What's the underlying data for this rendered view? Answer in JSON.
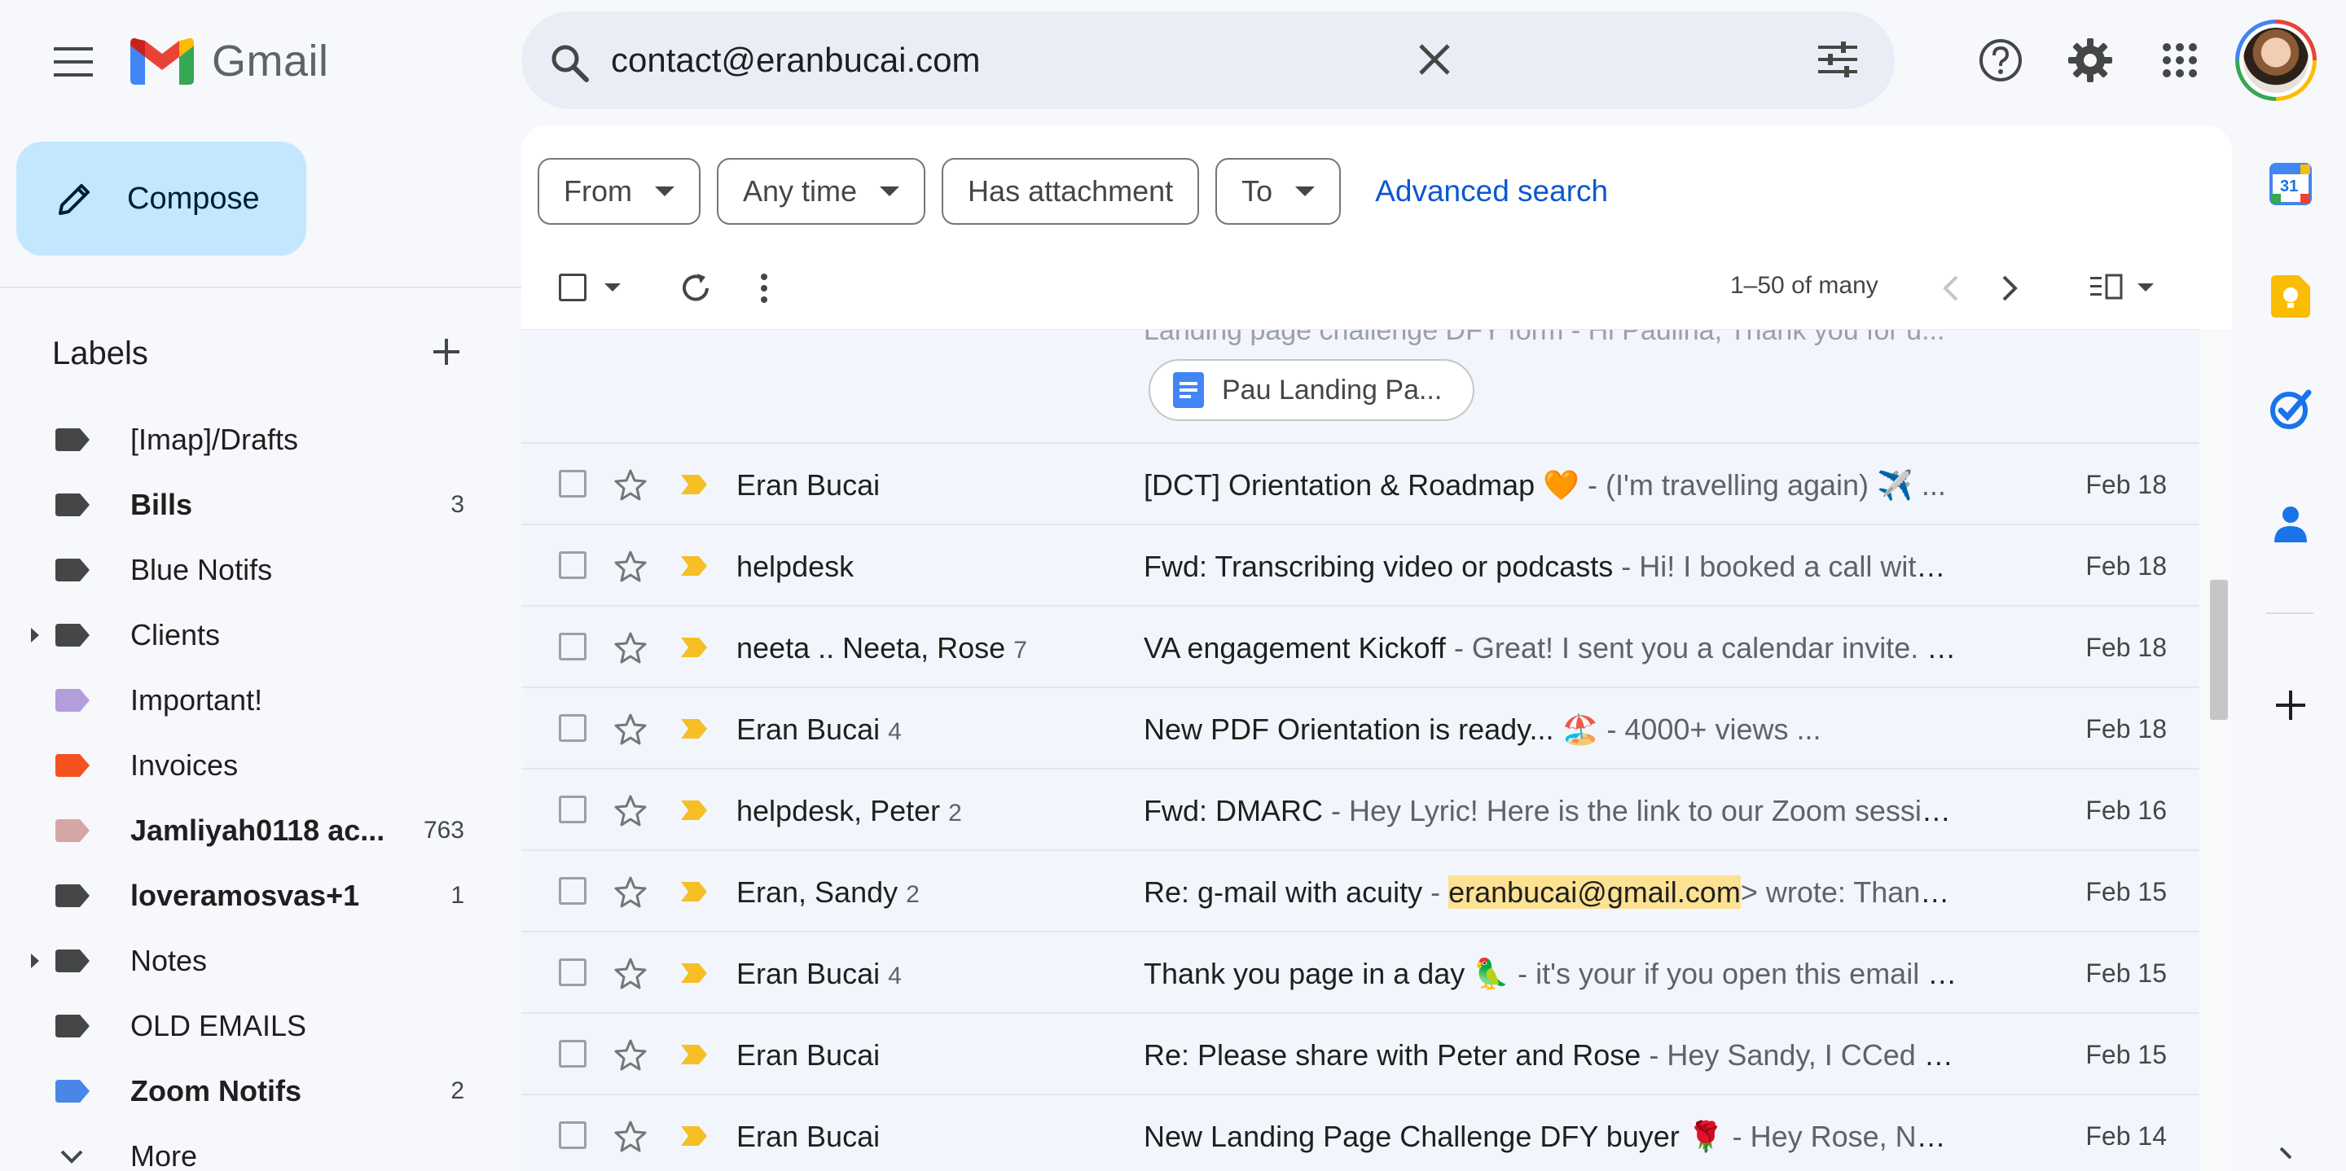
{
  "app": {
    "name": "Gmail",
    "main_menu_icon": "hamburger-menu-icon"
  },
  "search": {
    "value": "contact@eranbucai.com",
    "icon": "search-icon",
    "clear_icon": "close-icon",
    "options_icon": "tune-sliders-icon"
  },
  "header_icons": [
    "help-icon",
    "settings-gear-icon",
    "apps-grid-icon",
    "account-avatar"
  ],
  "compose": {
    "label": "Compose",
    "icon": "pencil-icon"
  },
  "labels_section": {
    "title": "Labels",
    "add_icon": "plus-icon",
    "items": [
      {
        "label": "[Imap]/Drafts",
        "count": "",
        "color": "#444746",
        "bold": false,
        "expandable": false
      },
      {
        "label": "Bills",
        "count": "3",
        "color": "#444746",
        "bold": true,
        "expandable": false
      },
      {
        "label": "Blue Notifs",
        "count": "",
        "color": "#444746",
        "bold": false,
        "expandable": false
      },
      {
        "label": "Clients",
        "count": "",
        "color": "#444746",
        "bold": false,
        "expandable": true
      },
      {
        "label": "Important!",
        "count": "",
        "color": "#b39ddb",
        "bold": false,
        "expandable": false
      },
      {
        "label": "Invoices",
        "count": "",
        "color": "#f4511e",
        "bold": false,
        "expandable": false
      },
      {
        "label": "Jamliyah0118 ac...",
        "count": "763",
        "color": "#d5a6a6",
        "bold": true,
        "expandable": false
      },
      {
        "label": "loveramosvas+1",
        "count": "1",
        "color": "#444746",
        "bold": true,
        "expandable": false
      },
      {
        "label": "Notes",
        "count": "",
        "color": "#444746",
        "bold": false,
        "expandable": true
      },
      {
        "label": "OLD EMAILS",
        "count": "",
        "color": "#444746",
        "bold": false,
        "expandable": false
      },
      {
        "label": "Zoom Notifs",
        "count": "2",
        "color": "#4a86e8",
        "bold": true,
        "expandable": false
      },
      {
        "label": "More",
        "count": "",
        "color": "",
        "bold": false,
        "expandable": false
      }
    ]
  },
  "filters": {
    "from": "From",
    "any_time": "Any time",
    "has_attachment": "Has attachment",
    "to": "To",
    "advanced": "Advanced search"
  },
  "toolbar": {
    "range": "1–50 of many",
    "icons": [
      "select-checkbox",
      "refresh-icon",
      "more-vert-icon",
      "chevron-left-icon",
      "chevron-right-icon",
      "split-pane-icon"
    ]
  },
  "partial_row": {
    "ghost_text": "Landing page challenge DFY form - Hi Paulina, Thank you for u...",
    "attachment_name": "Pau Landing Pa...",
    "attachment_icon": "google-docs-icon"
  },
  "emails": [
    {
      "sender": "Eran Bucai",
      "count": "",
      "subject": "[DCT] Orientation & Roadmap 🧡",
      "snippet": " - (I'm travelling again) ✈️        ...",
      "highlight": "",
      "snippet_after": "",
      "date": "Feb 18"
    },
    {
      "sender": "helpdesk",
      "count": "",
      "subject": "Fwd: Transcribing video or podcasts",
      "snippet": " - Hi! I booked a call with P...",
      "highlight": "",
      "snippet_after": "",
      "date": "Feb 18"
    },
    {
      "sender": "neeta .. Neeta, Rose",
      "count": "7",
      "subject": "VA engagement Kickoff",
      "snippet": " - Great! I sent you a calendar invite. O...",
      "highlight": "",
      "snippet_after": "",
      "date": "Feb 18"
    },
    {
      "sender": "Eran Bucai",
      "count": "4",
      "subject": "New PDF Orientation is ready... 🏖️",
      "snippet": " - 4000+ views              ...",
      "highlight": "",
      "snippet_after": "",
      "date": "Feb 18"
    },
    {
      "sender": "helpdesk, Peter",
      "count": "2",
      "subject": "Fwd: DMARC",
      "snippet": " - Hey Lyric! Here is the link to our Zoom session: ...",
      "highlight": "",
      "snippet_after": "",
      "date": "Feb 16"
    },
    {
      "sender": "Eran, Sandy",
      "count": "2",
      "subject": "Re: g-mail with acuity",
      "snippet": " - ",
      "highlight": "eranbucai@gmail.com",
      "snippet_after": "> wrote: Thanks ...",
      "date": "Feb 15"
    },
    {
      "sender": "Eran Bucai",
      "count": "4",
      "subject": "Thank you page in a day 🦜",
      "snippet": " - it's your if you open this email 🙋🏻‍♂️...",
      "highlight": "",
      "snippet_after": "",
      "date": "Feb 15"
    },
    {
      "sender": "Eran Bucai",
      "count": "",
      "subject": "Re: Please share with Peter and Rose",
      "snippet": " - Hey Sandy, I CCed Ros...",
      "highlight": "",
      "snippet_after": "",
      "date": "Feb 15"
    },
    {
      "sender": "Eran Bucai",
      "count": "",
      "subject": "New Landing Page Challenge DFY buyer 🌹",
      "snippet": " - Hey Rose, Nadeg...",
      "highlight": "",
      "snippet_after": "",
      "date": "Feb 14"
    }
  ],
  "side_panel": {
    "calendar_badge": "31",
    "apps": [
      "google-calendar-icon",
      "google-keep-icon",
      "google-tasks-icon",
      "google-contacts-icon",
      "add-addon-plus-icon",
      "hide-panel-chevron-icon"
    ]
  },
  "colors": {
    "compose_bg": "#c2e7ff",
    "search_bg": "#e9eef6",
    "accent_link": "#0b57d0",
    "importance_marker": "#f6bf26",
    "highlight": "#fde293"
  }
}
